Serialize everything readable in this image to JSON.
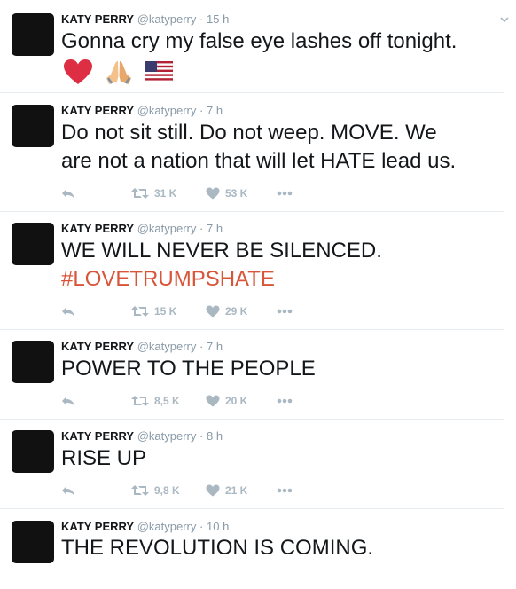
{
  "tweets": [
    {
      "name": "KATY PERRY",
      "handle": "@katyperry",
      "sep": "·",
      "time": "15 h",
      "lines": [
        "Gonna cry my false eye lashes off tonight."
      ],
      "hashtag": "",
      "emoji": [
        "red-heart-icon",
        "folded-hands-icon",
        "us-flag-icon"
      ],
      "retweets": "",
      "likes": ""
    },
    {
      "name": "KATY PERRY",
      "handle": "@katyperry",
      "sep": "·",
      "time": "7 h",
      "lines": [
        "Do not sit still. Do not weep. MOVE. We",
        "are not a nation that will let HATE lead us."
      ],
      "hashtag": "",
      "retweets": "31 K",
      "likes": "53 K"
    },
    {
      "name": "KATY PERRY",
      "handle": "@katyperry",
      "sep": "·",
      "time": "7 h",
      "lines": [
        "WE WILL NEVER BE SILENCED."
      ],
      "hashtag": "#LOVETRUMPSHATE",
      "retweets": "15 K",
      "likes": "29 K"
    },
    {
      "name": "KATY PERRY",
      "handle": "@katyperry",
      "sep": "·",
      "time": "7 h",
      "lines": [
        "POWER TO THE PEOPLE"
      ],
      "hashtag": "",
      "retweets": "8,5 K",
      "likes": "20 K"
    },
    {
      "name": "KATY PERRY",
      "handle": "@katyperry",
      "sep": "·",
      "time": "8 h",
      "lines": [
        "RISE UP"
      ],
      "hashtag": "",
      "retweets": "9,8 K",
      "likes": "21 K"
    },
    {
      "name": "KATY PERRY",
      "handle": "@katyperry",
      "sep": "·",
      "time": "10 h",
      "lines": [
        "THE REVOLUTION IS COMING."
      ],
      "hashtag": "",
      "retweets": "",
      "likes": ""
    }
  ],
  "colors": {
    "hashtag": "#d9553a",
    "meta": "#8899a6",
    "action": "#aab8c2"
  }
}
